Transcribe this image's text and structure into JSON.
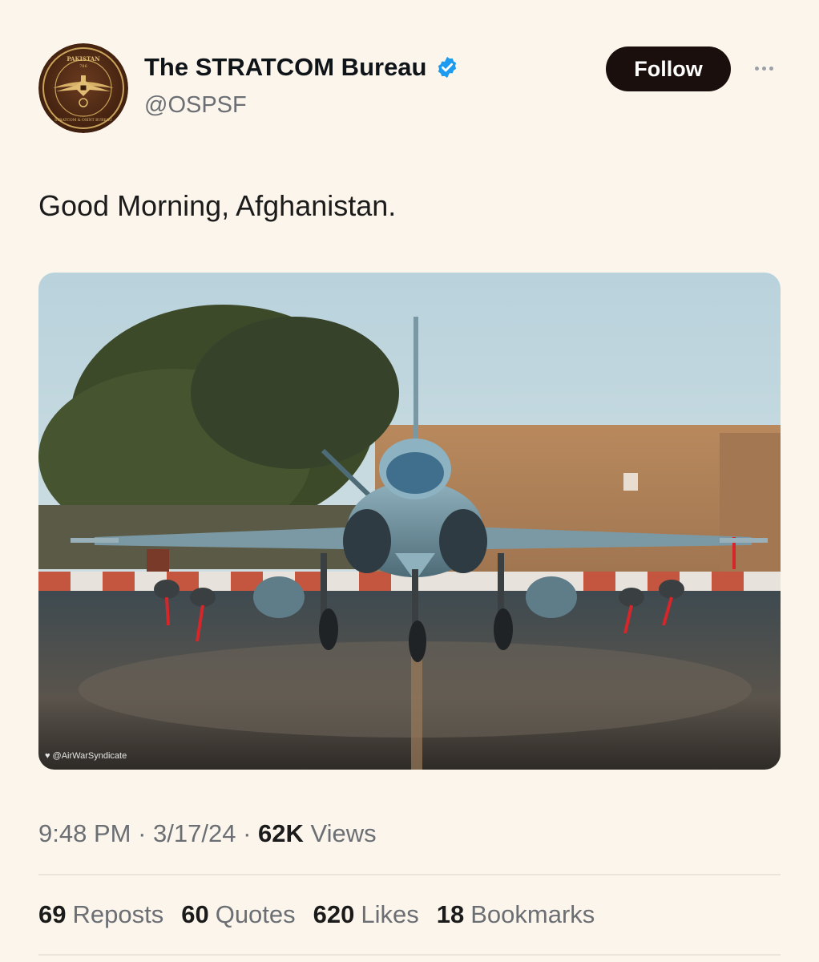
{
  "account": {
    "display_name": "The STRATCOM Bureau",
    "handle": "@OSPSF",
    "verified": true,
    "avatar": {
      "emblem_top_text": "PAKISTAN",
      "emblem_bottom_text": "STRATCOM & OSINT BUREAU",
      "emblem_number": "786"
    }
  },
  "actions": {
    "follow_label": "Follow",
    "more_icon": "more-horizontal-icon"
  },
  "tweet": {
    "text": "Good Morning, Afghanistan.",
    "media": {
      "description_icon": "jet-photo",
      "watermark": "@AirWarSyndicate"
    }
  },
  "meta": {
    "time": "9:48 PM",
    "sep1": " · ",
    "date": "3/17/24",
    "sep2": " · ",
    "views_count": "62K",
    "views_label": "Views"
  },
  "stats": [
    {
      "count": "69",
      "label": "Reposts"
    },
    {
      "count": "60",
      "label": "Quotes"
    },
    {
      "count": "620",
      "label": "Likes"
    },
    {
      "count": "18",
      "label": "Bookmarks"
    }
  ],
  "colors": {
    "background": "#fcf5eb",
    "follow_button": "#1a0f0d",
    "verified_badge": "#1d9bf0",
    "secondary_text": "#6b6f74"
  }
}
